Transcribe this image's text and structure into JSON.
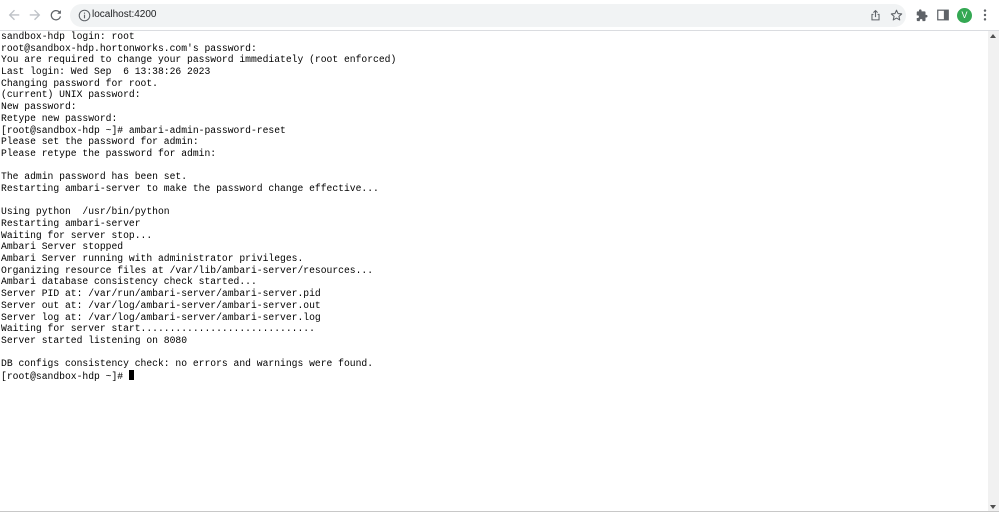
{
  "browser": {
    "url": "localhost:4200",
    "profile_initial": "V",
    "icons": {
      "back": "arrow-left-icon",
      "forward": "arrow-right-icon",
      "reload": "reload-icon",
      "site_info": "info-icon",
      "share": "share-icon",
      "bookmark": "star-icon",
      "extensions": "puzzle-icon",
      "side_panel": "side-panel-icon",
      "menu": "kebab-menu-icon"
    },
    "colors": {
      "avatar": "#34a853",
      "omnibox": "#f1f3f4"
    }
  },
  "terminal": {
    "lines": [
      "sandbox-hdp login: root",
      "root@sandbox-hdp.hortonworks.com's password:",
      "You are required to change your password immediately (root enforced)",
      "Last login: Wed Sep  6 13:38:26 2023",
      "Changing password for root.",
      "(current) UNIX password:",
      "New password:",
      "Retype new password:",
      "[root@sandbox-hdp ~]# ambari-admin-password-reset",
      "Please set the password for admin:",
      "Please retype the password for admin:",
      "",
      "The admin password has been set.",
      "Restarting ambari-server to make the password change effective...",
      "",
      "Using python  /usr/bin/python",
      "Restarting ambari-server",
      "Waiting for server stop...",
      "Ambari Server stopped",
      "Ambari Server running with administrator privileges.",
      "Organizing resource files at /var/lib/ambari-server/resources...",
      "Ambari database consistency check started...",
      "Server PID at: /var/run/ambari-server/ambari-server.pid",
      "Server out at: /var/log/ambari-server/ambari-server.out",
      "Server log at: /var/log/ambari-server/ambari-server.log",
      "Waiting for server start..............................",
      "Server started listening on 8080",
      "",
      "DB configs consistency check: no errors and warnings were found."
    ],
    "prompt": "[root@sandbox-hdp ~]# "
  }
}
